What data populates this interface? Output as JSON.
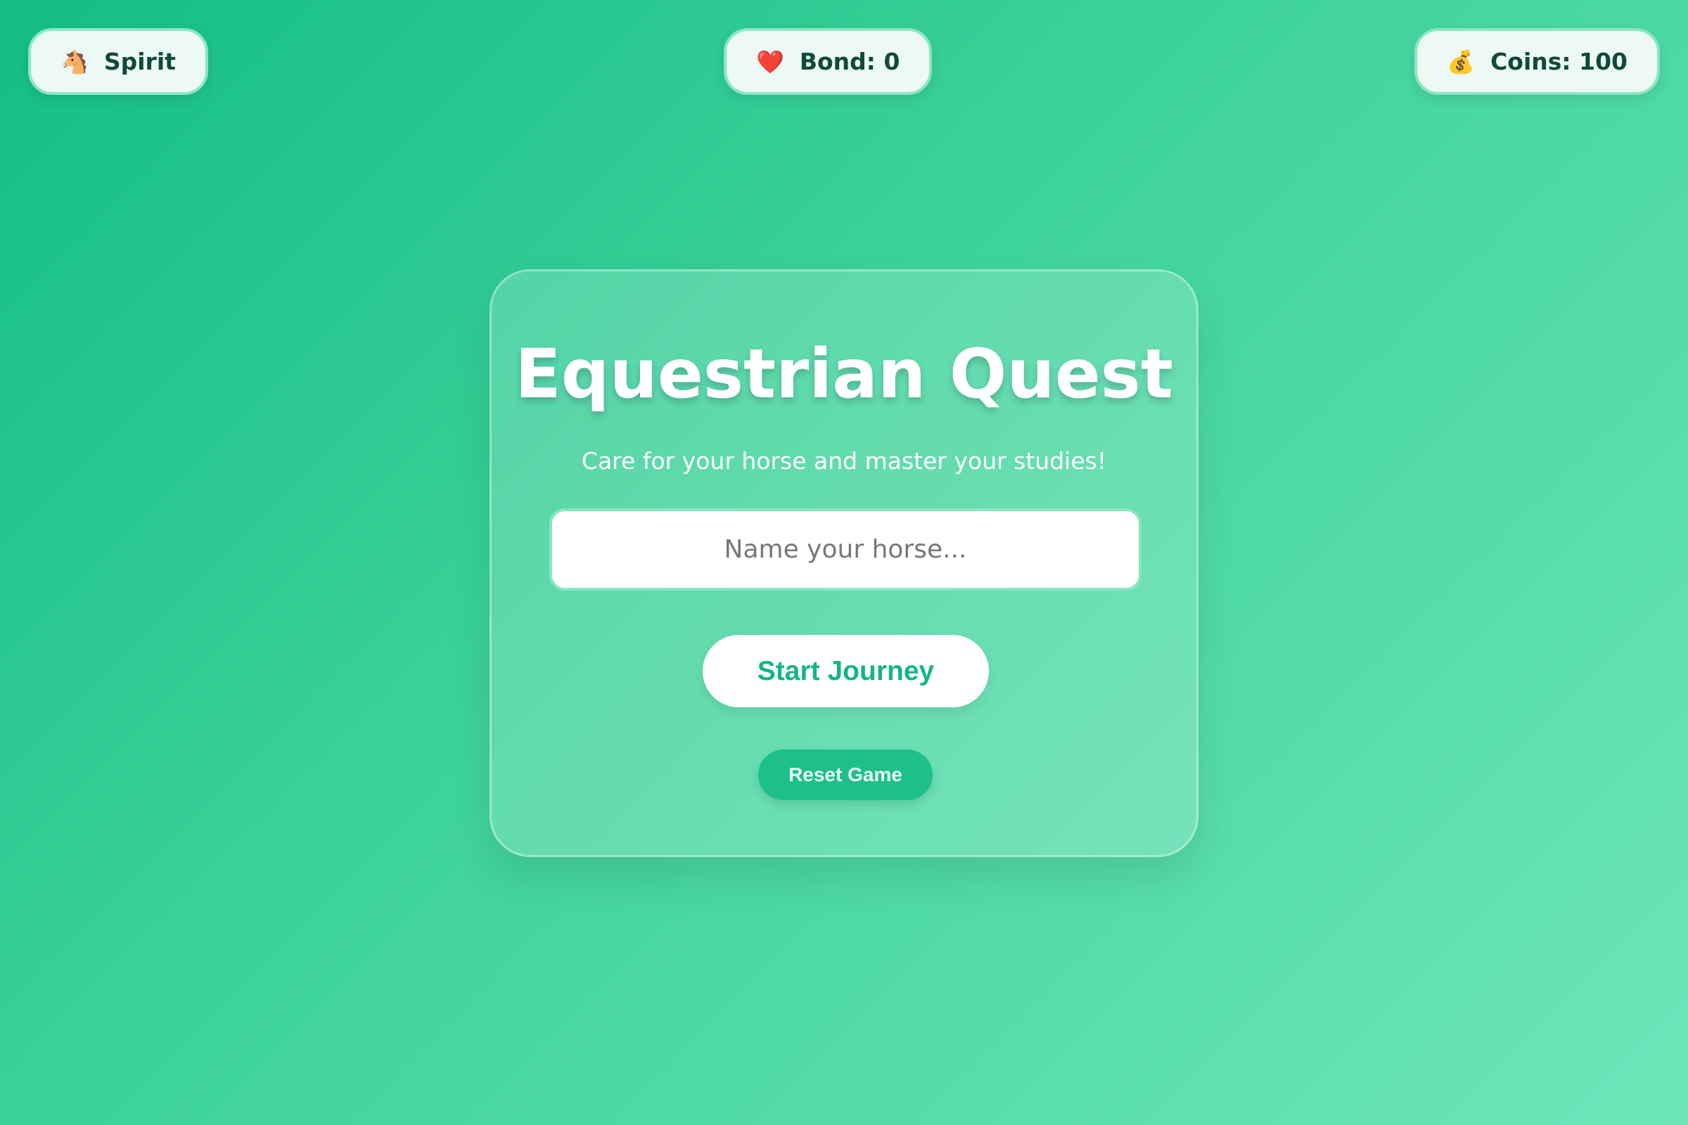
{
  "status_bar": {
    "horse": {
      "icon": "horse-face-icon",
      "label": "Spirit"
    },
    "bond": {
      "icon": "red-heart-icon",
      "label": "Bond: 0"
    },
    "coins": {
      "icon": "money-bag-icon",
      "label": "Coins: 100"
    }
  },
  "card": {
    "title": "Equestrian Quest",
    "subtitle": "Care for your horse and master your studies!",
    "name_input": {
      "placeholder": "Name your horse...",
      "value": ""
    },
    "start_button": "Start Journey",
    "reset_button": "Reset Game"
  },
  "colors": {
    "background_start": "#14bd86",
    "background_end": "#6ee6ba",
    "accent": "#14b585",
    "pill_text": "#0f4a36"
  }
}
